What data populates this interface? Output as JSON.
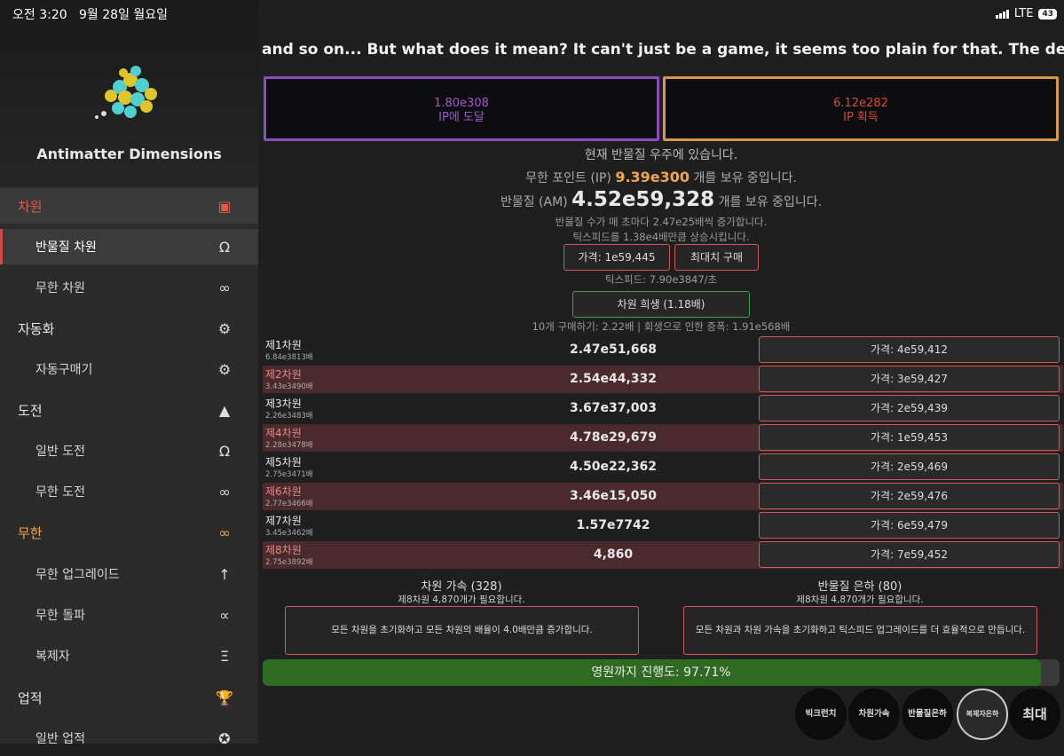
{
  "status": {
    "time": "오전 3:20",
    "date": "9월 28일 월요일",
    "network": "LTE",
    "battery": "43"
  },
  "app": {
    "title": "Antimatter Dimensions"
  },
  "sidebar": {
    "items": [
      {
        "label": "차원",
        "icon": "cube-icon"
      },
      {
        "label": "반물질 차원",
        "icon": "omega-icon"
      },
      {
        "label": "무한 차원",
        "icon": "infinity-icon"
      },
      {
        "label": "자동화",
        "icon": "gears-icon"
      },
      {
        "label": "자동구매기",
        "icon": "gear-icon"
      },
      {
        "label": "도전",
        "icon": "mountain-icon"
      },
      {
        "label": "일반 도전",
        "icon": "omega-icon"
      },
      {
        "label": "무한 도전",
        "icon": "infinity-icon"
      },
      {
        "label": "무한",
        "icon": "infinity-icon"
      },
      {
        "label": "무한 업그레이드",
        "icon": "arrow-up-icon"
      },
      {
        "label": "무한 돌파",
        "icon": "proportional-icon"
      },
      {
        "label": "복제자",
        "icon": "replicanti-icon"
      },
      {
        "label": "업적",
        "icon": "trophy-icon"
      },
      {
        "label": "일반 업적",
        "icon": "medal-icon"
      }
    ]
  },
  "news": "and so on... But what does it mean? It can't just be a game, it seems too plain for that. The developer must have",
  "top_buttons": {
    "left": {
      "value": "1.80e308",
      "label": "IP에 도달"
    },
    "right": {
      "value": "6.12e282",
      "label": "IP 획득"
    }
  },
  "info": {
    "universe": "현재 반물질 우주에 있습니다.",
    "ip_prefix": "무한 포인트 (IP) ",
    "ip_value": "9.39e300",
    "ip_suffix": " 개를 보유 중입니다.",
    "am_prefix": "반물질 (AM) ",
    "am_value": "4.52e59,328",
    "am_suffix": " 개를 보유 중입니다.",
    "am_rate": "반물질 수가 매 초마다 2.47e25배씩 증가합니다.",
    "tick_boost": "틱스피드를 1.38e4배만큼 상승시킵니다.",
    "tick_price": "가격: 1e59,445",
    "max_buy": "최대치 구매",
    "tickspeed": "틱스피드: 7.90e3847/초",
    "sacrifice": "차원 희생 (1.18배)",
    "sacrifice_info": "10개 구매하기: 2.22배  |  회생으로 인한 증폭: 1.91e568배"
  },
  "dimensions": [
    {
      "name": "제1차원",
      "mult": "6.84e3813배",
      "amount": "2.47e51,668",
      "price": "가격: 4e59,412"
    },
    {
      "name": "제2차원",
      "mult": "3.43e3490배",
      "amount": "2.54e44,332",
      "price": "가격: 3e59,427"
    },
    {
      "name": "제3차원",
      "mult": "2.26e3483배",
      "amount": "3.67e37,003",
      "price": "가격: 2e59,439"
    },
    {
      "name": "제4차원",
      "mult": "2.28e3478배",
      "amount": "4.78e29,679",
      "price": "가격: 1e59,453"
    },
    {
      "name": "제5차원",
      "mult": "2.75e3471배",
      "amount": "4.50e22,362",
      "price": "가격: 2e59,469"
    },
    {
      "name": "제6차원",
      "mult": "2.77e3466배",
      "amount": "3.46e15,050",
      "price": "가격: 2e59,476"
    },
    {
      "name": "제7차원",
      "mult": "3.45e3462배",
      "amount": "1.57e7742",
      "price": "가격: 6e59,479"
    },
    {
      "name": "제8차원",
      "mult": "2.75e3892배",
      "amount": "4,860",
      "price": "가격: 7e59,452"
    }
  ],
  "boost": {
    "title": "차원 가속 (328)",
    "req": "제8차원 4,870개가 필요합니다.",
    "desc": "모든 차원을 초기화하고 모든 차원의 배율이 4.0배만큼 증가합니다."
  },
  "galaxy": {
    "title": "반물질 은하 (80)",
    "req": "제8차원 4,870개가 필요합니다.",
    "desc": "모든 차원과 차원 가속을 초기화하고 틱스피드 업그레이드를 더 효율적으로 만듭니다."
  },
  "progress": {
    "label": "영원까지 진행도: 97.71%",
    "percent": 97.71,
    "fill_color": "#2e6a22"
  },
  "round_buttons": {
    "big_crunch": "빅크런치",
    "dim_boost": "차원가속",
    "galaxy": "반물질은하",
    "replicanti_galaxy": "복제자은하",
    "max": "최대"
  }
}
